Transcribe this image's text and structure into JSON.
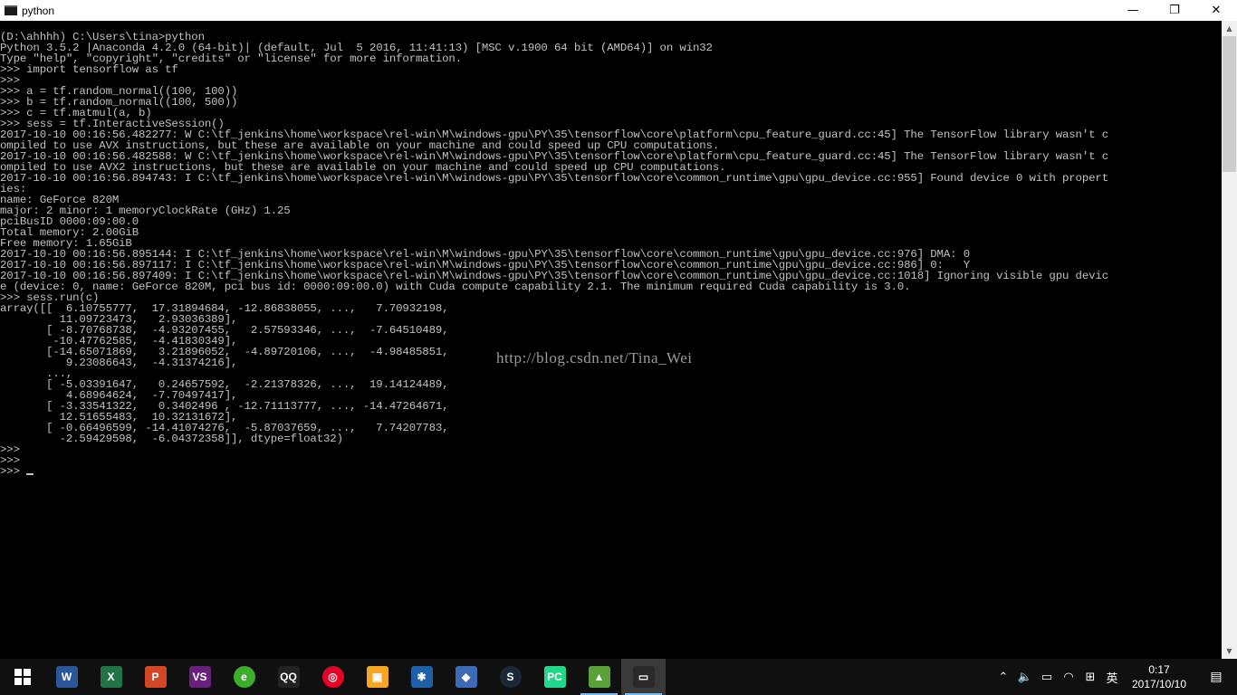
{
  "window": {
    "title": "python",
    "icon": "console-icon",
    "controls": {
      "minimize": "—",
      "maximize": "❐",
      "close": "✕"
    }
  },
  "console": {
    "lines": [
      "",
      "(D:\\ahhhh) C:\\Users\\tina>python",
      "Python 3.5.2 |Anaconda 4.2.0 (64-bit)| (default, Jul  5 2016, 11:41:13) [MSC v.1900 64 bit (AMD64)] on win32",
      "Type \"help\", \"copyright\", \"credits\" or \"license\" for more information.",
      ">>> import tensorflow as tf",
      ">>>",
      ">>> a = tf.random_normal((100, 100))",
      ">>> b = tf.random_normal((100, 500))",
      ">>> c = tf.matmul(a, b)",
      ">>> sess = tf.InteractiveSession()",
      "2017-10-10 00:16:56.482277: W C:\\tf_jenkins\\home\\workspace\\rel-win\\M\\windows-gpu\\PY\\35\\tensorflow\\core\\platform\\cpu_feature_guard.cc:45] The TensorFlow library wasn't c",
      "ompiled to use AVX instructions, but these are available on your machine and could speed up CPU computations.",
      "2017-10-10 00:16:56.482588: W C:\\tf_jenkins\\home\\workspace\\rel-win\\M\\windows-gpu\\PY\\35\\tensorflow\\core\\platform\\cpu_feature_guard.cc:45] The TensorFlow library wasn't c",
      "ompiled to use AVX2 instructions, but these are available on your machine and could speed up CPU computations.",
      "2017-10-10 00:16:56.894743: I C:\\tf_jenkins\\home\\workspace\\rel-win\\M\\windows-gpu\\PY\\35\\tensorflow\\core\\common_runtime\\gpu\\gpu_device.cc:955] Found device 0 with propert",
      "ies:",
      "name: GeForce 820M",
      "major: 2 minor: 1 memoryClockRate (GHz) 1.25",
      "pciBusID 0000:09:00.0",
      "Total memory: 2.00GiB",
      "Free memory: 1.65GiB",
      "2017-10-10 00:16:56.895144: I C:\\tf_jenkins\\home\\workspace\\rel-win\\M\\windows-gpu\\PY\\35\\tensorflow\\core\\common_runtime\\gpu\\gpu_device.cc:976] DMA: 0",
      "2017-10-10 00:16:56.897117: I C:\\tf_jenkins\\home\\workspace\\rel-win\\M\\windows-gpu\\PY\\35\\tensorflow\\core\\common_runtime\\gpu\\gpu_device.cc:986] 0:   Y",
      "2017-10-10 00:16:56.897409: I C:\\tf_jenkins\\home\\workspace\\rel-win\\M\\windows-gpu\\PY\\35\\tensorflow\\core\\common_runtime\\gpu\\gpu_device.cc:1018] Ignoring visible gpu devic",
      "e (device: 0, name: GeForce 820M, pci bus id: 0000:09:00.0) with Cuda compute capability 2.1. The minimum required Cuda capability is 3.0.",
      ">>> sess.run(c)",
      "array([[  6.10755777,  17.31894684, -12.86838055, ...,   7.70932198,",
      "         11.09723473,   2.93036389],",
      "       [ -8.70768738,  -4.93207455,   2.57593346, ...,  -7.64510489,",
      "        -10.47762585,  -4.41830349],",
      "       [-14.65071869,   3.21896052,  -4.89720106, ...,  -4.98485851,",
      "          9.23086643,  -4.31374216],",
      "       ...,",
      "       [ -5.03391647,   0.24657592,  -2.21378326, ...,  19.14124489,",
      "          4.68964624,  -7.70497417],",
      "       [ -3.33541322,   0.3402496 , -12.71113777, ..., -14.47264671,",
      "         12.51655483,  10.32131672],",
      "       [ -0.66496599, -14.41074276,  -5.87037659, ...,   7.74207783,",
      "         -2.59429598,  -6.04372358]], dtype=float32)",
      ">>>",
      ">>>",
      ">>> "
    ],
    "watermark": "http://blog.csdn.net/Tina_Wei"
  },
  "scrollbar": {
    "up_arrow": "▲",
    "down_arrow": "▼"
  },
  "taskbar": {
    "apps": [
      {
        "name": "start",
        "icon": "windows-logo-icon",
        "label": "",
        "color": "#ffffff"
      },
      {
        "name": "word",
        "icon": "word-icon",
        "label": "W",
        "color": "#2b579a"
      },
      {
        "name": "excel",
        "icon": "excel-icon",
        "label": "X",
        "color": "#217346"
      },
      {
        "name": "powerpoint",
        "icon": "powerpoint-icon",
        "label": "P",
        "color": "#d24726"
      },
      {
        "name": "visual-studio",
        "icon": "visual-studio-icon",
        "label": "VS",
        "color": "#68217a"
      },
      {
        "name": "browser-360",
        "icon": "browser-360-icon",
        "label": "e",
        "color": "#3dae2b"
      },
      {
        "name": "qq",
        "icon": "qq-penguin-icon",
        "label": "QQ",
        "color": "#222222"
      },
      {
        "name": "netease-music",
        "icon": "netease-music-icon",
        "label": "◎",
        "color": "#e60026"
      },
      {
        "name": "file-manager",
        "icon": "file-manager-icon",
        "label": "▣",
        "color": "#f5a623"
      },
      {
        "name": "network-tool",
        "icon": "network-tool-icon",
        "label": "✱",
        "color": "#1e5fa8"
      },
      {
        "name": "vm-tool",
        "icon": "virtualbox-icon",
        "label": "◆",
        "color": "#3d6bb3"
      },
      {
        "name": "steam",
        "icon": "steam-icon",
        "label": "S",
        "color": "#1b2838"
      },
      {
        "name": "pycharm",
        "icon": "pycharm-icon",
        "label": "PC",
        "color": "#21d789"
      },
      {
        "name": "minecraft",
        "icon": "minecraft-icon",
        "label": "▲",
        "color": "#5aa13a"
      },
      {
        "name": "cmd",
        "icon": "cmd-console-icon",
        "label": "▭",
        "color": "#2a2a2a"
      }
    ],
    "tray": {
      "chevron": "⌃",
      "volume": "🔈",
      "battery": "▭",
      "wifi": "◠",
      "ime_mode": "⊞",
      "language": "英",
      "time": "0:17",
      "date": "2017/10/10",
      "notification": "▤"
    }
  }
}
